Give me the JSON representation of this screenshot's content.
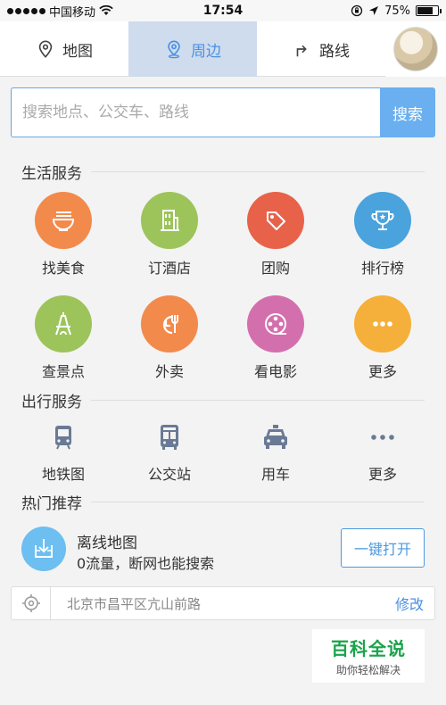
{
  "status_bar": {
    "carrier": "中国移动",
    "time": "17:54",
    "battery": "75%",
    "battery_level": 0.75
  },
  "tabs": [
    {
      "label": "地图",
      "icon": "map-pin-outline-icon",
      "active": false
    },
    {
      "label": "周边",
      "icon": "nearby-pin-icon",
      "active": true
    },
    {
      "label": "路线",
      "icon": "route-arrow-icon",
      "active": false
    }
  ],
  "search": {
    "placeholder": "搜索地点、公交车、路线",
    "button_label": "搜索"
  },
  "life_services": {
    "title": "生活服务",
    "items": [
      {
        "label": "找美食",
        "icon": "noodle-bowl-icon",
        "color": "#f28a4c"
      },
      {
        "label": "订酒店",
        "icon": "hotel-building-icon",
        "color": "#9cc45a"
      },
      {
        "label": "团购",
        "icon": "price-tag-icon",
        "color": "#e8624a"
      },
      {
        "label": "排行榜",
        "icon": "trophy-icon",
        "color": "#4aa3dc"
      },
      {
        "label": "查景点",
        "icon": "eiffel-tower-icon",
        "color": "#9cc45a"
      },
      {
        "label": "外卖",
        "icon": "plate-fork-icon",
        "color": "#f28a4c"
      },
      {
        "label": "看电影",
        "icon": "film-reel-icon",
        "color": "#d46fae"
      },
      {
        "label": "更多",
        "icon": "more-dots-icon",
        "color": "#f4b03a"
      }
    ]
  },
  "travel_services": {
    "title": "出行服务",
    "items": [
      {
        "label": "地铁图",
        "icon": "subway-icon"
      },
      {
        "label": "公交站",
        "icon": "bus-icon"
      },
      {
        "label": "用车",
        "icon": "taxi-icon"
      },
      {
        "label": "更多",
        "icon": "more-dots-icon"
      }
    ]
  },
  "hot": {
    "title": "热门推荐",
    "offline_title": "离线地图",
    "offline_desc": "0流量，断网也能搜索",
    "open_button": "一键打开"
  },
  "location": {
    "address": "北京市昌平区亢山前路",
    "edit_label": "修改"
  },
  "watermark": {
    "main": "百科全说",
    "sub": "助你轻松解决"
  }
}
